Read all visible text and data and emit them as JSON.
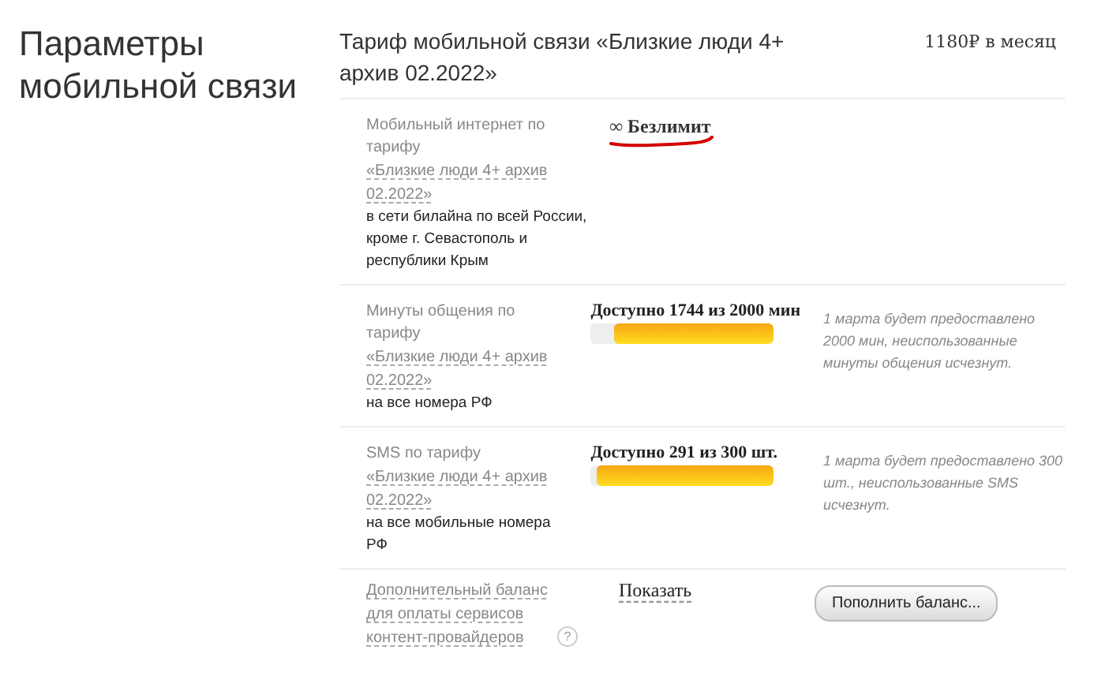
{
  "section_title": "Параметры мобильной связи",
  "tariff": {
    "title": "Тариф мобильной связи «Близкие люди 4+ архив 02.2022»",
    "price": "1180₽ в месяц"
  },
  "rows": [
    {
      "kind": "unlimited",
      "label": "Мобильный интернет по тарифу",
      "link": "«Близкие люди 4+ архив 02.2022»",
      "description": "в сети билайна по всей России, кроме г. Севастополь и республики Крым",
      "value": "∞ Безлимит",
      "underlined": true
    },
    {
      "kind": "meter",
      "label": "Минуты общения по тарифу",
      "link": "«Близкие люди 4+ архив 02.2022»",
      "description": "на все номера РФ",
      "value": "Доступно 1744 из 2000 мин",
      "level": 0.87,
      "note": "1 марта будет предоставлено 2000 мин, неиспользованные минуты общения исчезнут."
    },
    {
      "kind": "meter",
      "label": "SMS по тарифу",
      "link": "«Близкие люди 4+ архив 02.2022»",
      "description": "на все мобильные номера РФ",
      "value": "Доступно 291 из 300 шт.",
      "level": 0.97,
      "note": "1 марта будет предоставлено 300 шт., неиспользованные SMS исчезнут."
    },
    {
      "kind": "balance",
      "link": "Дополнительный баланс для оплаты сервисов контент-провайдеров",
      "help": "?",
      "value": "Показать",
      "button": "Пополнить баланс..."
    }
  ]
}
